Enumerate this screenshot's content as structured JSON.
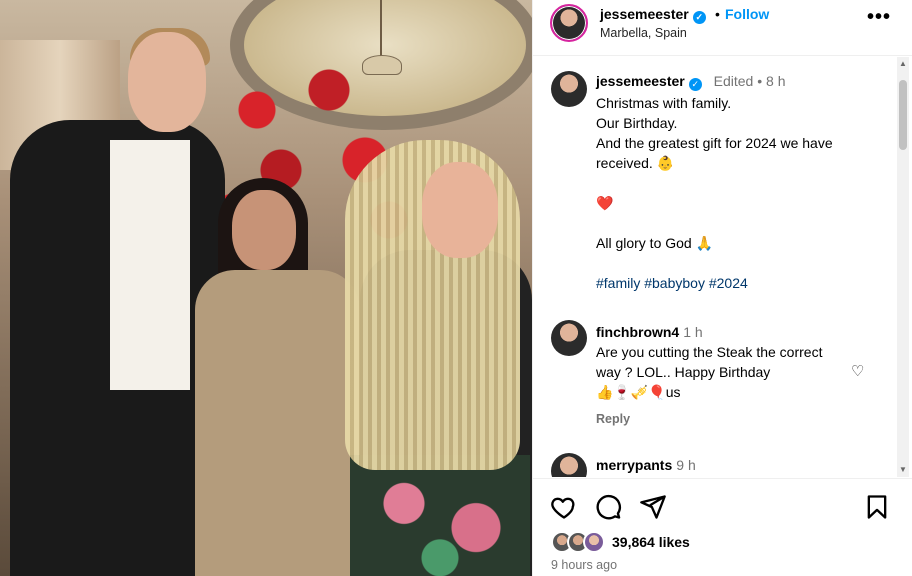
{
  "post": {
    "username": "jessemeester",
    "verified_badge": "✓",
    "dot": "•",
    "follow_label": "Follow",
    "location": "Marbella, Spain",
    "more_icon": "more-horizontal-icon"
  },
  "caption": {
    "username": "jessemeester",
    "meta": "Edited • 8 h",
    "lines": [
      "Christmas with family.",
      "Our Birthday.",
      "And the greatest gift for 2024 we have received. 👶",
      "",
      "❤️",
      "",
      "All glory to God 🙏",
      "",
      "#family #babyboy #2024"
    ]
  },
  "comments": [
    {
      "username": "finchbrown4",
      "time": "1 h",
      "text": "Are you cutting the Steak the correct way ? LOL.. Happy Birthday",
      "emoji_line": "👍🍷🎺🎈us",
      "reply_label": "Reply"
    },
    {
      "username": "merrypants",
      "time": "9 h"
    }
  ],
  "actions": {
    "like_icon": "heart-icon",
    "comment_icon": "comment-icon",
    "share_icon": "send-icon",
    "save_icon": "bookmark-icon"
  },
  "likes": {
    "count_text": "39,864 likes",
    "time_ago": "9 hours ago"
  },
  "colors": {
    "link_blue": "#0095f6",
    "hashtag": "#00376b",
    "muted": "#737373"
  }
}
